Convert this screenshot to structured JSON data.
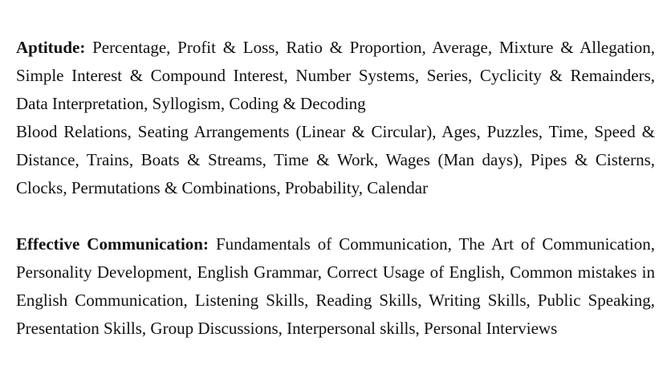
{
  "sections": [
    {
      "heading": "Aptitude:",
      "paragraph_1": "Percentage, Profit & Loss, Ratio & Proportion, Average, Mixture & Allegation, Simple Interest & Compound Interest,  Number Systems, Series, Cyclicity & Remainders, Data Interpretation, Syllogism, Coding & Decoding",
      "paragraph_2": "Blood Relations, Seating Arrangements (Linear & Circular), Ages, Puzzles, Time, Speed & Distance, Trains, Boats & Streams, Time & Work, Wages (Man days), Pipes & Cisterns, Clocks, Permutations & Combinations, Probability, Calendar"
    },
    {
      "heading": "Effective Communication:",
      "paragraph_1": "Fundamentals of Communication, The Art of Communication, Personality Development, English Grammar, Correct Usage of English,  Common mistakes in English Communication, Listening Skills, Reading Skills, Writing Skills,  Public Speaking, Presentation Skills, Group Discussions, Interpersonal skills, Personal Interviews"
    }
  ]
}
